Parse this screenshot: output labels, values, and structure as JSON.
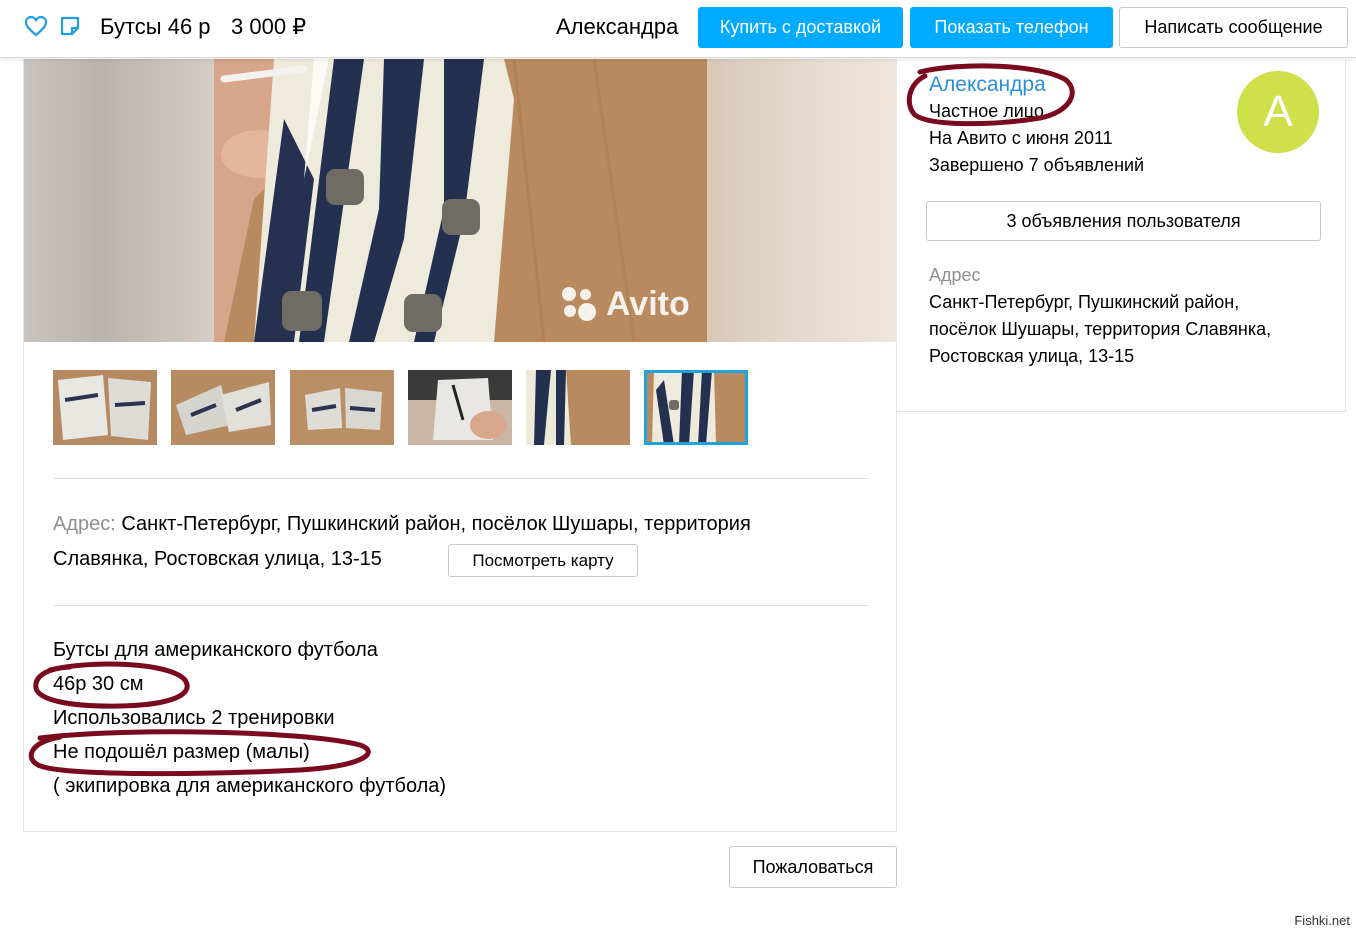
{
  "topbar": {
    "title": "Бутсы 46 р",
    "price": "3 000 ₽",
    "seller": "Александра",
    "buy_delivery": "Купить с доставкой",
    "show_phone": "Показать телефон",
    "write_message": "Написать сообщение"
  },
  "gallery": {
    "watermark": "Avito",
    "thumbnail_count": 6,
    "selected_thumbnail": 6
  },
  "address": {
    "label": "Адрес:",
    "line1": "Санкт-Петербург, Пушкинский район, посёлок Шушары, территория",
    "line2": "Славянка, Ростовская улица, 13-15",
    "map_button": "Посмотреть карту"
  },
  "description": [
    "Бутсы для американского футбола",
    "46р 30 см",
    "Использовались 2 тренировки",
    "Не подошёл размер (малы)",
    "( экипировка для американского футбола)"
  ],
  "complain": "Пожаловаться",
  "seller": {
    "name": "Александра",
    "type": "Частное лицо",
    "since": "На Авито с июня 2011",
    "completed": "Завершено 7 объявлений",
    "avatar_letter": "А",
    "ads_button": "3 объявления пользователя",
    "address_label": "Адрес",
    "address_lines": [
      "Санкт-Петербург, Пушкинский район,",
      "посёлок Шушары, территория Славянка,",
      "Ростовская улица, 13-15"
    ]
  },
  "site_mark": "Fishki.net",
  "colors": {
    "accent_blue": "#00aaff",
    "link_blue": "#2a8fd6",
    "avatar_green": "#cfe04a",
    "annotation_red": "#7a0a1e"
  }
}
